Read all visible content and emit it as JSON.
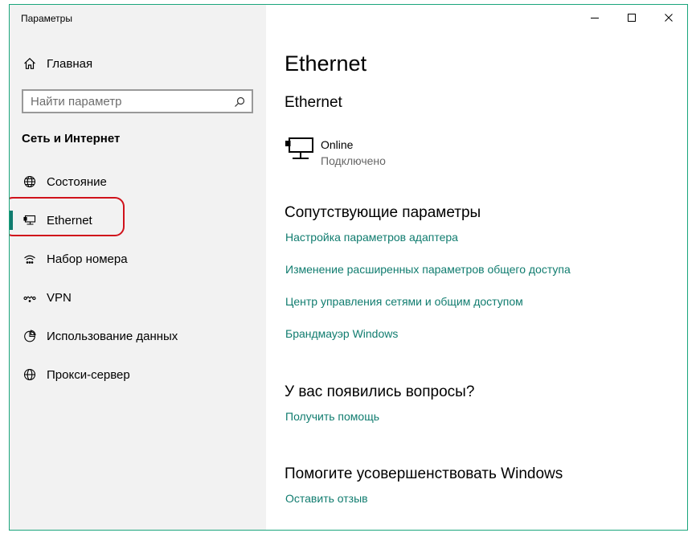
{
  "window": {
    "title": "Параметры",
    "controls": {
      "minimize": "minimize",
      "maximize": "maximize",
      "close": "close"
    }
  },
  "sidebar": {
    "home_label": "Главная",
    "search_placeholder": "Найти параметр",
    "section_title": "Сеть и Интернет",
    "items": [
      {
        "label": "Состояние",
        "icon": "globe-status-icon",
        "selected": false
      },
      {
        "label": "Ethernet",
        "icon": "ethernet-icon",
        "selected": true
      },
      {
        "label": "Набор номера",
        "icon": "dialup-icon",
        "selected": false
      },
      {
        "label": "VPN",
        "icon": "vpn-icon",
        "selected": false
      },
      {
        "label": "Использование данных",
        "icon": "data-usage-icon",
        "selected": false
      },
      {
        "label": "Прокси-сервер",
        "icon": "globe-icon",
        "selected": false
      }
    ]
  },
  "main": {
    "page_title": "Ethernet",
    "subtitle": "Ethernet",
    "connection": {
      "name": "Online",
      "status": "Подключено"
    },
    "related": {
      "heading": "Сопутствующие параметры",
      "links": [
        "Настройка параметров адаптера",
        "Изменение расширенных параметров общего доступа",
        "Центр управления сетями и общим доступом",
        "Брандмауэр Windows"
      ]
    },
    "help": {
      "heading": "У вас появились вопросы?",
      "link": "Получить помощь"
    },
    "improve": {
      "heading": "Помогите усовершенствовать Windows",
      "link": "Оставить отзыв"
    }
  },
  "colors": {
    "accent": "#107c6f",
    "link": "#107c6f",
    "sidebar_bg": "#f2f2f2",
    "highlight_ring": "#d0121b"
  }
}
